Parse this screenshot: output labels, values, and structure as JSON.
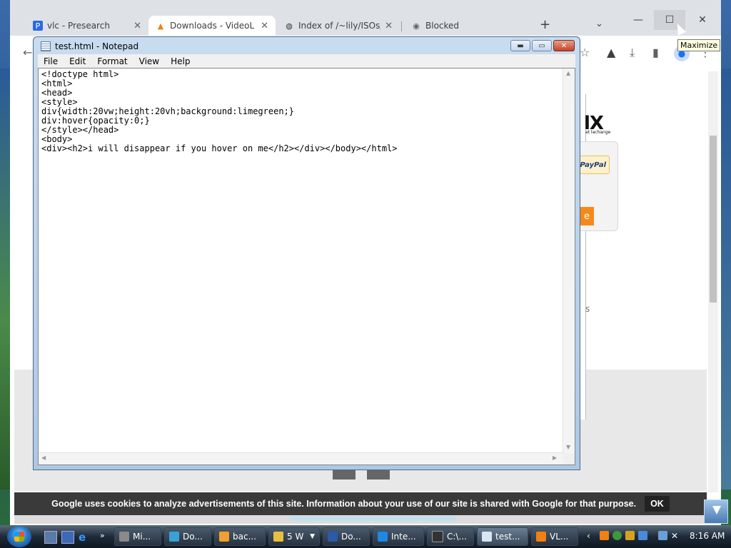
{
  "browser": {
    "tabs": [
      {
        "title": "vlc - Presearch",
        "icon": "presearch-icon"
      },
      {
        "title": "Downloads - VideoL",
        "icon": "vlc-cone-icon"
      },
      {
        "title": "Index of /~lily/ISOs/",
        "icon": "globe-server-icon"
      },
      {
        "title": "Blocked",
        "icon": "globe-icon"
      }
    ],
    "new_tab_symbol": "+",
    "tab_search_symbol": "⌄",
    "window_controls": {
      "minimize": "—",
      "maximize": "☐",
      "close": "✕"
    },
    "tooltip": "Maximize"
  },
  "page": {
    "logo_fragment": "lX",
    "logo_subtext": "at lachange",
    "paypal_label": "PayPal",
    "orange_button_fragment": "e",
    "text_fragment": "s"
  },
  "notepad": {
    "title": "test.html - Notepad",
    "menu": [
      "File",
      "Edit",
      "Format",
      "View",
      "Help"
    ],
    "content": "<!doctype html>\n<html>\n<head>\n<style>\ndiv{width:20vw;height:20vh;background:limegreen;}\ndiv:hover{opacity:0;}\n</style></head>\n<body>\n<div><h2>i will disappear if you hover on me</h2></div></body></html>"
  },
  "cookie_bar": {
    "text": "Google uses cookies to analyze advertisements of this site. Information about your use of our site is shared with Google for that purpose.",
    "ok_label": "OK"
  },
  "taskbar": {
    "buttons": [
      {
        "label": "Mi...",
        "color": "#8a8a8a"
      },
      {
        "label": "Do...",
        "color": "#3aa0d8"
      },
      {
        "label": "bac...",
        "color": "#f0a030"
      },
      {
        "label": "5 W",
        "color": "#e8c040"
      },
      {
        "label": "Do...",
        "color": "#2a5aa8"
      },
      {
        "label": "Inte...",
        "color": "#1e88e5"
      },
      {
        "label": "C:\\...",
        "color": "#333333"
      },
      {
        "label": "test...",
        "color": "#d8e6f4"
      },
      {
        "label": "VL...",
        "color": "#f08010"
      }
    ],
    "clock": "8:16 AM"
  }
}
